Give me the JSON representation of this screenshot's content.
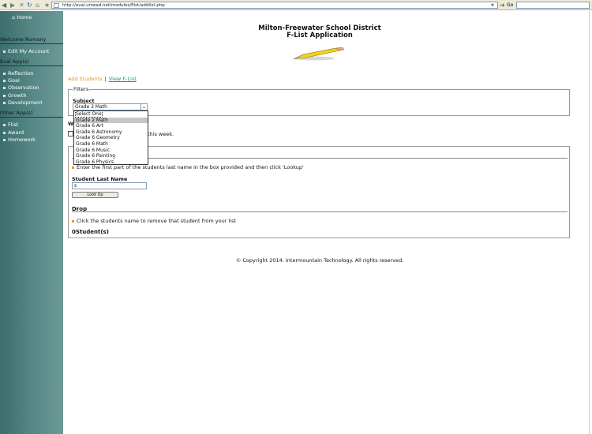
{
  "browser": {
    "url": "http://eval.umead.net/modules/flist/addlist.php",
    "go_label": "Go"
  },
  "sidebar": {
    "home": "Home",
    "welcome": "Welcome Romany",
    "edit_account": "Edit My Account",
    "eval_apps_heading": "Eval App(s)",
    "eval_apps": [
      "Reflection",
      "Goal",
      "Observation",
      "Growth",
      "Development"
    ],
    "other_apps_heading": "Other App(s)",
    "other_apps": [
      "Flist",
      "Award",
      "Homework"
    ]
  },
  "header": {
    "district": "Milton-Freewater School District",
    "app_title": "F-List Application"
  },
  "nav": {
    "add_students": "Add Students",
    "separator": "|",
    "view_flist": "View F-List"
  },
  "filters": {
    "legend": "Filters",
    "subject_label": "Subject",
    "subject_value": "Grade 2 Math",
    "options": [
      "Select One",
      "Grade 2 Math",
      "Grade 6 Art",
      "Grade 6 Astronomy",
      "Grade 6 Geometry",
      "Grade 6 Math",
      "Grade 6 Music",
      "Grade 6 Painting",
      "Grade 6 Physics"
    ],
    "selected_index": 1,
    "focused_index": 0
  },
  "week": {
    "label_visible": "W",
    "text_visible": "this week."
  },
  "students": {
    "add_instruction_visible": "Enter the first part of the students last name in the box provided and then click 'Lookup'",
    "lastname_label": "Student Last Name",
    "lastname_value": "s",
    "lookup_button": "Look Up",
    "drop_heading": "Drop",
    "drop_instruction": "Click the students name to remove that student from your list",
    "student_count": "0Student(s)"
  },
  "footer": {
    "copyright": "© Copyright 2014. Intermountain Technology. All rights reserved."
  }
}
